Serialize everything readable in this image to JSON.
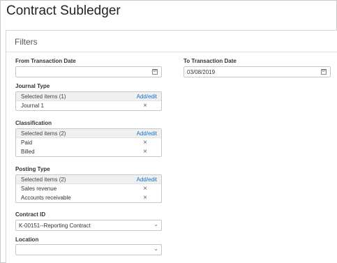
{
  "page": {
    "title": "Contract Subledger"
  },
  "filters": {
    "title": "Filters",
    "from_date": {
      "label": "From Transaction Date",
      "value": ""
    },
    "to_date": {
      "label": "To Transaction Date",
      "value": "03/08/2019"
    },
    "journal_type": {
      "label": "Journal Type",
      "selected": "Selected items (1)",
      "add_edit": "Add/edit",
      "items": [
        "Journal 1"
      ]
    },
    "classification": {
      "label": "Classification",
      "selected": "Selected items (2)",
      "add_edit": "Add/edit",
      "items": [
        "Paid",
        "Billed"
      ]
    },
    "posting_type": {
      "label": "Posting Type",
      "selected": "Selected items (2)",
      "add_edit": "Add/edit",
      "items": [
        "Sales revenue",
        "Accounts receivable"
      ]
    },
    "contract_id": {
      "label": "Contract ID",
      "value": "K-00151--Reporting Contract"
    },
    "location": {
      "label": "Location",
      "value": ""
    }
  },
  "icons": {
    "calendar": "calendar-icon",
    "remove": "close-icon",
    "dropdown": "chevron-down-icon"
  },
  "colors": {
    "link": "#1a6fc4",
    "selected_header_bg": "#eef0f2"
  }
}
